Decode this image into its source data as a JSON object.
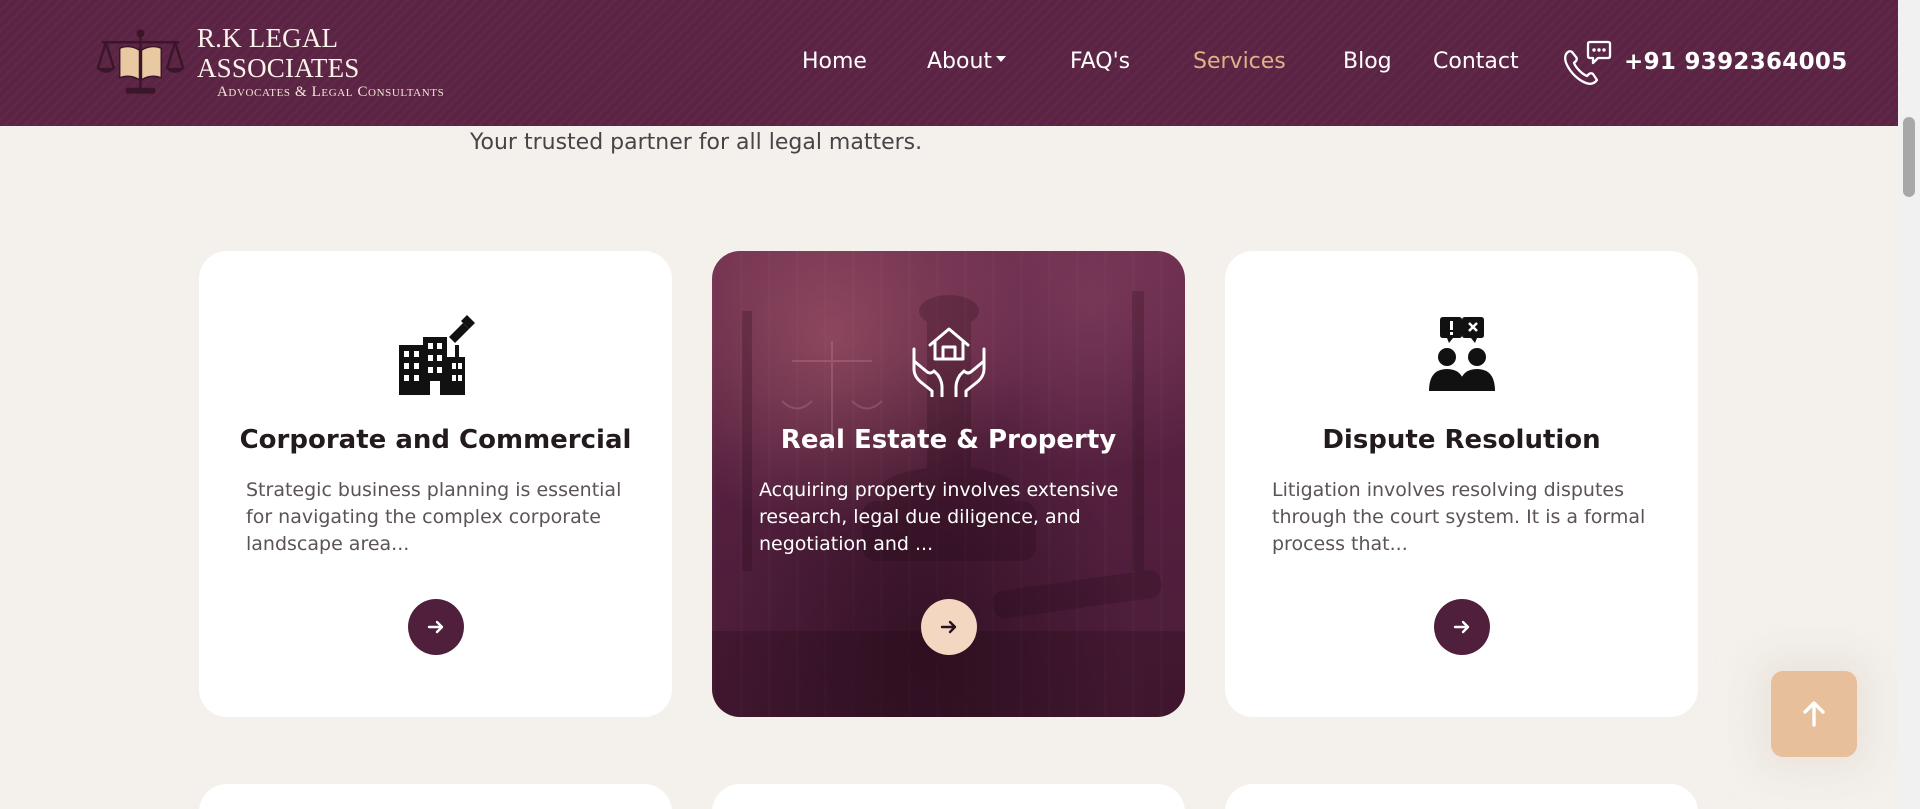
{
  "header": {
    "logo": {
      "title": "R.K LEGAL ASSOCIATES",
      "subtitle": "Advocates & Legal Consultants"
    },
    "nav": {
      "home": "Home",
      "about": "About",
      "faqs": "FAQ's",
      "services": "Services",
      "blog": "Blog",
      "contact": "Contact"
    },
    "active_nav": "Services",
    "phone": {
      "icon": "phone-chat-icon",
      "number": "+91  9392364005"
    }
  },
  "main": {
    "tagline": "Your trusted partner for all legal matters.",
    "cards": [
      {
        "icon": "corporate-building-icon",
        "title": "Corporate and Commercial",
        "description": "Strategic business planning is essential for navigating the complex corporate landscape area...",
        "button_icon": "arrow-right-icon"
      },
      {
        "icon": "house-in-hands-icon",
        "title": "Real Estate & Property",
        "description": "Acquiring property involves extensive research, legal due diligence, and negotiation and ...",
        "button_icon": "arrow-right-icon",
        "featured": true
      },
      {
        "icon": "dispute-people-icon",
        "title": "Dispute Resolution",
        "description": "Litigation involves resolving disputes through the court system. It is a formal process that...",
        "button_icon": "arrow-right-icon"
      }
    ],
    "back_to_top_icon": "arrow-up-icon"
  },
  "colors": {
    "header_bg": "#5c2444",
    "active_nav": "#e0b288",
    "page_bg": "#f4f1ec",
    "card_bg": "#ffffff",
    "featured_card_bg": "#52203c",
    "button_dark": "#4f1f3b",
    "button_light": "#f3d7c0",
    "back_to_top": "#e8bf9b"
  }
}
